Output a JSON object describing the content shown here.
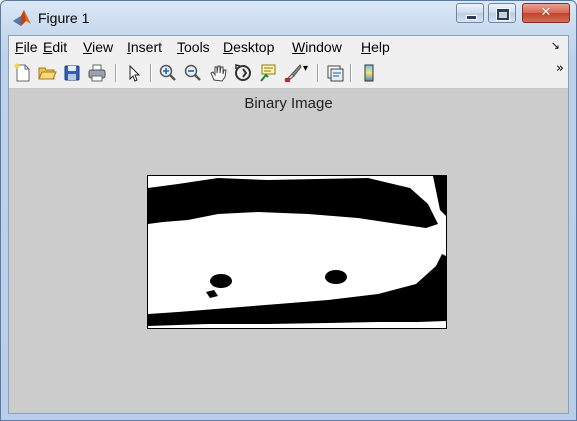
{
  "window": {
    "title": "Figure 1",
    "close_glyph": "✕"
  },
  "menubar": {
    "items": [
      {
        "accel": "F",
        "rest": "ile"
      },
      {
        "accel": "E",
        "rest": "dit"
      },
      {
        "accel": "V",
        "rest": "iew"
      },
      {
        "accel": "I",
        "rest": "nsert"
      },
      {
        "accel": "T",
        "rest": "ools"
      },
      {
        "accel": "D",
        "rest": "esktop"
      },
      {
        "accel": "W",
        "rest": "indow"
      },
      {
        "accel": "H",
        "rest": "elp"
      }
    ],
    "overflow": "↘"
  },
  "toolbar": {
    "icons": [
      "new-figure-icon",
      "open-folder-icon",
      "save-icon",
      "print-icon",
      "select-arrow-icon",
      "zoom-in-icon",
      "zoom-out-icon",
      "pan-hand-icon",
      "rotate-3d-icon",
      "data-cursor-icon",
      "brush-icon",
      "link-plot-icon",
      "colorbar-icon"
    ],
    "overflow": "»"
  },
  "axes": {
    "title": "Binary Image"
  }
}
